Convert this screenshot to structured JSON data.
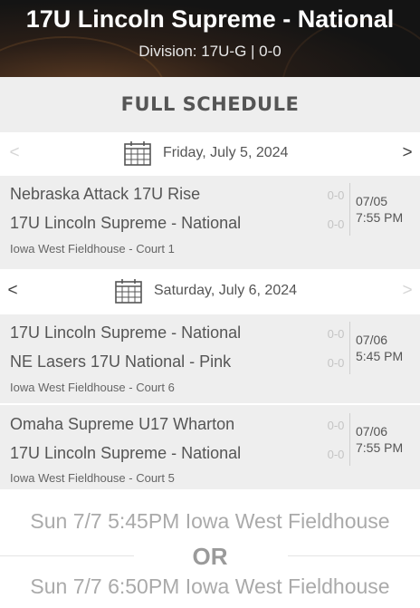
{
  "team_header": {
    "title": "17U Lincoln Supreme - National",
    "subtitle": "Division: 17U-G | 0-0"
  },
  "schedule": {
    "heading": "FULL SCHEDULE",
    "days": [
      {
        "date_label": "Friday, July 5, 2024",
        "prev_arrow": "<",
        "next_arrow": ">",
        "prev_enabled": false,
        "next_enabled": true,
        "games": [
          {
            "team1": "Nebraska Attack 17U Rise",
            "score1": "0-0",
            "team2": "17U Lincoln Supreme - National",
            "score2": "0-0",
            "date": "07/05",
            "time": "7:55 PM",
            "venue": "Iowa West Fieldhouse - Court 1"
          }
        ]
      },
      {
        "date_label": "Saturday, July 6, 2024",
        "prev_arrow": "<",
        "next_arrow": ">",
        "prev_enabled": true,
        "next_enabled": false,
        "games": [
          {
            "team1": "17U Lincoln Supreme - National",
            "score1": "0-0",
            "team2": "NE Lasers 17U National - Pink",
            "score2": "0-0",
            "date": "07/06",
            "time": "5:45 PM",
            "venue": "Iowa West Fieldhouse - Court 6"
          },
          {
            "team1": "Omaha Supreme U17 Wharton",
            "score1": "0-0",
            "team2": "17U Lincoln Supreme - National",
            "score2": "0-0",
            "date": "07/06",
            "time": "7:55 PM",
            "venue": "Iowa West Fieldhouse - Court 5"
          }
        ]
      }
    ]
  },
  "upcoming": {
    "option1": "Sun 7/7 5:45PM Iowa West Fieldhouse",
    "separator": "OR",
    "option2": "Sun 7/7 6:50PM Iowa West Fieldhouse"
  },
  "icons": {
    "calendar": "calendar-icon",
    "prev": "chevron-left-icon",
    "next": "chevron-right-icon"
  },
  "colors": {
    "header_bg": "#1a1a1a",
    "panel_bg": "#eeeeee",
    "text": "#555555",
    "muted": "#c4c4c4"
  }
}
